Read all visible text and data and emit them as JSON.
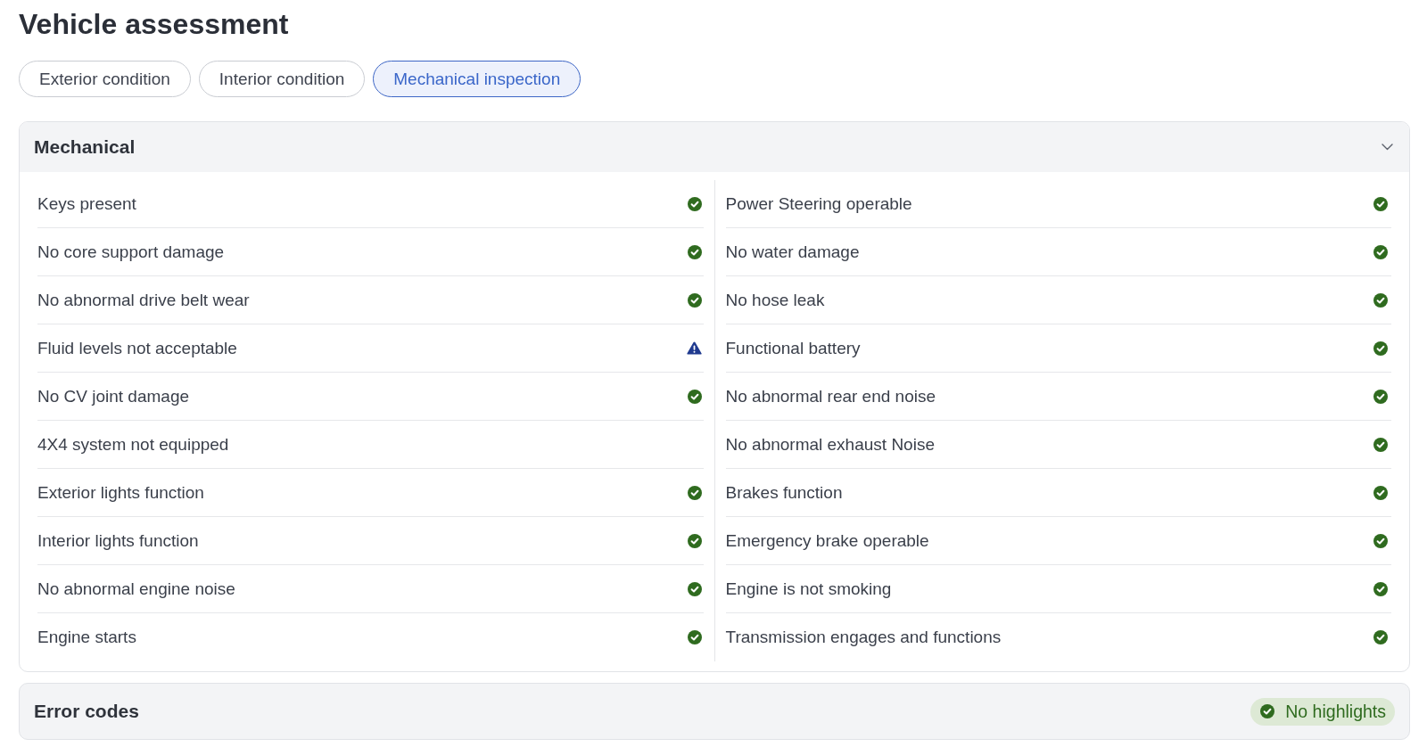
{
  "title": "Vehicle assessment",
  "tabs": [
    {
      "label": "Exterior condition",
      "selected": false
    },
    {
      "label": "Interior condition",
      "selected": false
    },
    {
      "label": "Mechanical inspection",
      "selected": true
    }
  ],
  "mechanical": {
    "title": "Mechanical",
    "expanded": true,
    "columns": [
      {
        "items": [
          {
            "label": "Keys present",
            "kind": "check"
          },
          {
            "label": "No core support damage",
            "kind": "check"
          },
          {
            "label": "No abnormal drive belt wear",
            "kind": "check"
          },
          {
            "label": "Fluid levels not acceptable",
            "kind": "warning"
          },
          {
            "label": "No CV joint damage",
            "kind": "check"
          },
          {
            "label": "4X4 system not equipped",
            "kind": "plain"
          },
          {
            "label": "Exterior lights function",
            "kind": "check"
          },
          {
            "label": "Interior lights function",
            "kind": "check"
          },
          {
            "label": "No abnormal engine noise",
            "kind": "check"
          },
          {
            "label": "Engine starts",
            "kind": "check"
          }
        ]
      },
      {
        "items": [
          {
            "label": "Power Steering operable",
            "kind": "check"
          },
          {
            "label": "No water damage",
            "kind": "check"
          },
          {
            "label": "No hose leak",
            "kind": "check"
          },
          {
            "label": "Functional battery",
            "kind": "check"
          },
          {
            "label": "No abnormal rear end noise",
            "kind": "check"
          },
          {
            "label": "No abnormal exhaust Noise",
            "kind": "check"
          },
          {
            "label": "Brakes function",
            "kind": "check"
          },
          {
            "label": "Emergency brake operable",
            "kind": "check"
          },
          {
            "label": "Engine is not smoking",
            "kind": "check"
          },
          {
            "label": "Transmission engages and functions",
            "kind": "check"
          }
        ]
      }
    ]
  },
  "error_codes": {
    "title": "Error codes",
    "badge": {
      "label": "No highlights",
      "kind": "check"
    }
  }
}
